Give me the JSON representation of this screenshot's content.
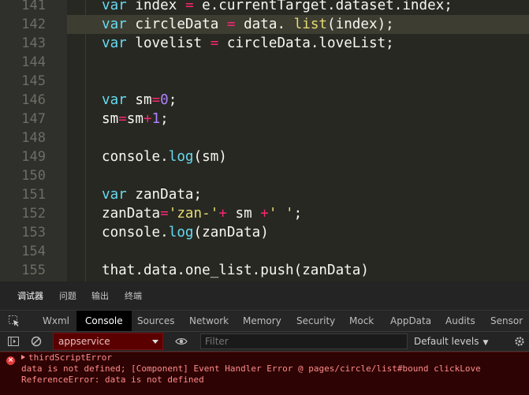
{
  "editor": {
    "lines": [
      {
        "num": "141",
        "tokens": [
          {
            "t": "var",
            "c": "kw"
          },
          {
            "t": " index "
          },
          {
            "t": "=",
            "c": "op"
          },
          {
            "t": " e.currentTarget.dataset.index;"
          }
        ]
      },
      {
        "num": "142",
        "active": true,
        "tokens": [
          {
            "t": "var",
            "c": "kw"
          },
          {
            "t": " circleData "
          },
          {
            "t": "=",
            "c": "op"
          },
          {
            "t": " data. "
          },
          {
            "t": "list",
            "c": "str"
          },
          {
            "t": "(index);"
          }
        ]
      },
      {
        "num": "143",
        "tokens": [
          {
            "t": "var",
            "c": "kw"
          },
          {
            "t": " lovelist "
          },
          {
            "t": "=",
            "c": "op"
          },
          {
            "t": " circleData.loveList;"
          }
        ]
      },
      {
        "num": "144",
        "tokens": []
      },
      {
        "num": "145",
        "tokens": []
      },
      {
        "num": "146",
        "tokens": [
          {
            "t": "var",
            "c": "kw"
          },
          {
            "t": " sm"
          },
          {
            "t": "=",
            "c": "op"
          },
          {
            "t": "0",
            "c": "num"
          },
          {
            "t": ";"
          }
        ]
      },
      {
        "num": "147",
        "tokens": [
          {
            "t": "sm"
          },
          {
            "t": "=",
            "c": "op"
          },
          {
            "t": "sm"
          },
          {
            "t": "+",
            "c": "op"
          },
          {
            "t": "1",
            "c": "num"
          },
          {
            "t": ";"
          }
        ]
      },
      {
        "num": "148",
        "tokens": []
      },
      {
        "num": "149",
        "tokens": [
          {
            "t": "console."
          },
          {
            "t": "log",
            "c": "kw"
          },
          {
            "t": "(sm)"
          }
        ]
      },
      {
        "num": "150",
        "tokens": []
      },
      {
        "num": "151",
        "tokens": [
          {
            "t": "var",
            "c": "kw"
          },
          {
            "t": " zanData;"
          }
        ]
      },
      {
        "num": "152",
        "tokens": [
          {
            "t": "zanData"
          },
          {
            "t": "=",
            "c": "op"
          },
          {
            "t": "'zan-'",
            "c": "str"
          },
          {
            "t": "+",
            "c": "op"
          },
          {
            "t": " sm "
          },
          {
            "t": "+",
            "c": "op"
          },
          {
            "t": "' '",
            "c": "str"
          },
          {
            "t": ";"
          }
        ]
      },
      {
        "num": "153",
        "tokens": [
          {
            "t": "console."
          },
          {
            "t": "log",
            "c": "kw"
          },
          {
            "t": "(zanData)"
          }
        ]
      },
      {
        "num": "154",
        "tokens": []
      },
      {
        "num": "155",
        "tokens": [
          {
            "t": "that.data.one_list.push(zanData)"
          }
        ]
      }
    ]
  },
  "devtools": {
    "top_tabs": [
      {
        "label": "调试器",
        "active": true
      },
      {
        "label": "问题"
      },
      {
        "label": "输出"
      },
      {
        "label": "终端"
      }
    ],
    "panel_tabs": [
      {
        "label": "Wxml"
      },
      {
        "label": "Console",
        "active": true
      },
      {
        "label": "Sources"
      },
      {
        "label": "Network"
      },
      {
        "label": "Memory"
      },
      {
        "label": "Security"
      },
      {
        "label": "Mock"
      },
      {
        "label": "AppData"
      },
      {
        "label": "Audits"
      },
      {
        "label": "Sensor"
      }
    ],
    "filter_bar": {
      "context": "appservice",
      "filter_placeholder": "Filter",
      "levels_label": "Default levels"
    },
    "console": {
      "error_icon": "×",
      "lines": [
        "thirdScriptError",
        "data is not defined; [Component] Event Handler Error @ pages/circle/list#bound clickLove",
        "ReferenceError: data is not defined"
      ]
    }
  },
  "colors": {
    "editor_bg": "#272822",
    "keyword": "#66d9ef",
    "number": "#ae81ff",
    "string": "#e6db74",
    "operator": "#f92672",
    "error_text": "#ff8b8b",
    "error_bg": "#2e0303"
  }
}
